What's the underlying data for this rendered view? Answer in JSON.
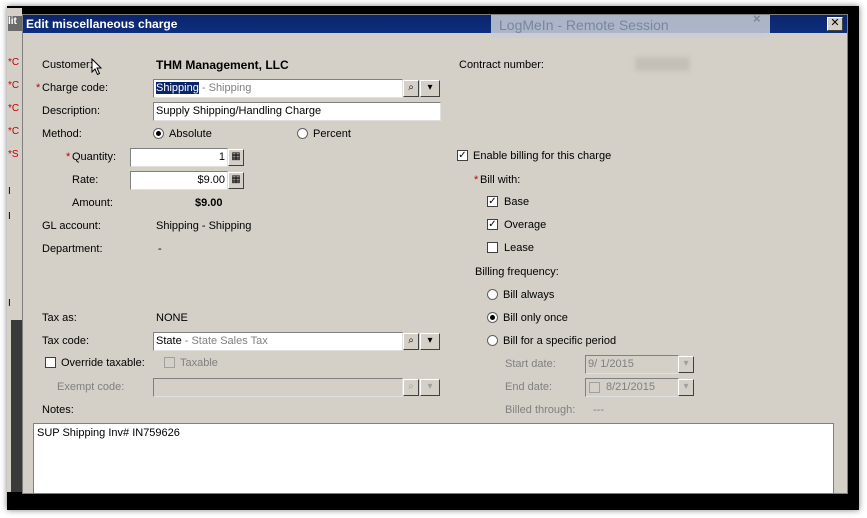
{
  "window": {
    "title": "Edit miscellaneous charge",
    "close_glyph": "✕"
  },
  "overlay": {
    "text": "LogMeIn -  Remote Session",
    "close_glyph": "×"
  },
  "background_app": {
    "title_fragment": "lit",
    "markers": [
      "*C",
      "*C",
      "*C",
      "*C",
      "*S"
    ],
    "fragments": [
      "I",
      "I",
      "I"
    ]
  },
  "form": {
    "customer_label": "Customer:",
    "customer_value": "THM Management, LLC",
    "charge_code_label": "Charge code:",
    "charge_code_selected": "Shipping",
    "charge_code_rest": " - Shipping",
    "description_label": "Description:",
    "description_value": "Supply Shipping/Handling Charge",
    "method_label": "Method:",
    "method_absolute": "Absolute",
    "method_percent": "Percent",
    "quantity_label": "Quantity:",
    "quantity_value": "1",
    "rate_label": "Rate:",
    "rate_value": "$9.00",
    "amount_label": "Amount:",
    "amount_value": "$9.00",
    "gl_label": "GL account:",
    "gl_value": "Shipping - Shipping",
    "department_label": "Department:",
    "department_value": "-",
    "tax_as_label": "Tax as:",
    "tax_as_value": "NONE",
    "tax_code_label": "Tax code:",
    "tax_code_primary": "State",
    "tax_code_rest": " - State Sales Tax",
    "override_label": "Override taxable:",
    "taxable_label": "Taxable",
    "exempt_label": "Exempt code:",
    "notes_label": "Notes:",
    "notes_value": "SUP Shipping Inv# IN759626",
    "required_marker": "*"
  },
  "billing": {
    "contract_label": "Contract number:",
    "enable_label": "Enable billing for this charge",
    "enable_checked": true,
    "bill_with_label": "Bill with:",
    "base_label": "Base",
    "base_checked": true,
    "overage_label": "Overage",
    "overage_checked": true,
    "lease_label": "Lease",
    "lease_checked": false,
    "frequency_label": "Billing frequency:",
    "freq_always": "Bill always",
    "freq_once": "Bill only once",
    "freq_period": "Bill for a specific period",
    "selected_frequency": "Bill only once",
    "start_label": "Start date:",
    "start_value": "9/  1/2015",
    "end_label": "End date:",
    "end_value": "8/21/2015",
    "billed_through_label": "Billed through:",
    "billed_through_value": "---"
  },
  "icons": {
    "lookup": "magnifier-icon",
    "dropdown": "list-dropdown-icon",
    "calculator": "calculator-icon",
    "check_glyph": "✓",
    "arrow_down": "▾"
  }
}
